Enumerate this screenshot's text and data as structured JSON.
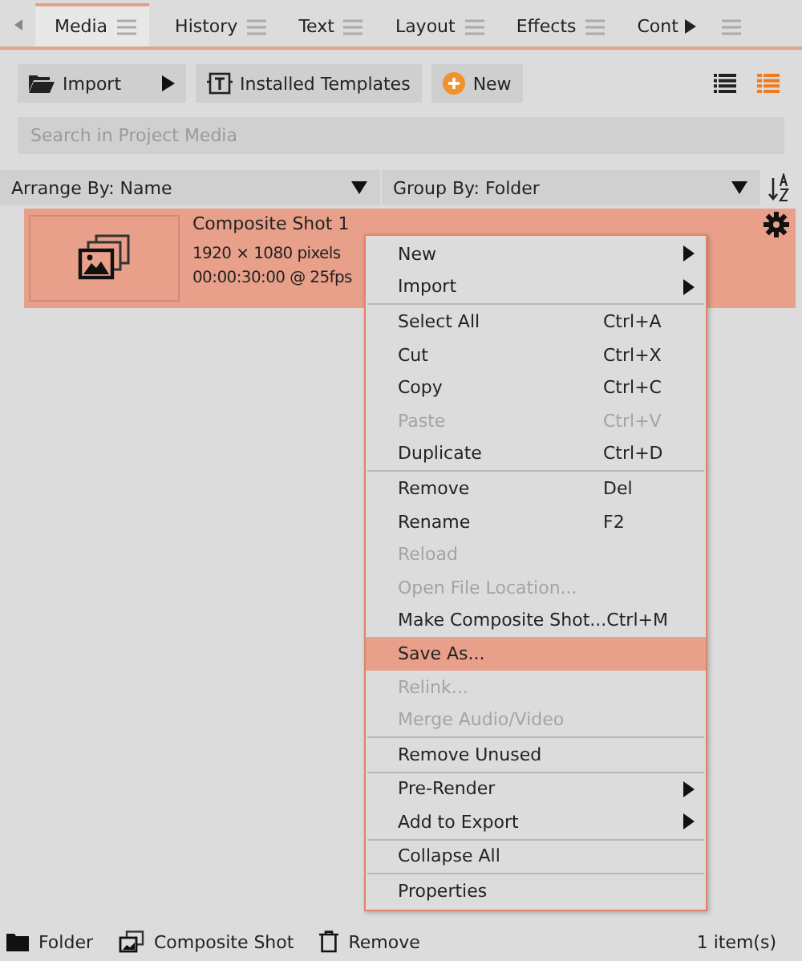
{
  "tabs": [
    {
      "label": "Media",
      "selected": true
    },
    {
      "label": "History",
      "selected": false
    },
    {
      "label": "Text",
      "selected": false
    },
    {
      "label": "Layout",
      "selected": false
    },
    {
      "label": "Effects",
      "selected": false
    },
    {
      "label": "Cont",
      "selected": false
    }
  ],
  "toolbar": {
    "buttons": [
      {
        "kind": "import",
        "label": "Import"
      },
      {
        "kind": "templates",
        "label": "Installed Templates"
      },
      {
        "kind": "new",
        "label": "New"
      }
    ],
    "views": [
      {
        "kind": "details",
        "selected": false
      },
      {
        "kind": "list",
        "selected": true
      }
    ]
  },
  "search": {
    "placeholder": "Search in Project Media"
  },
  "arrange": {
    "label": "Arrange By: Name"
  },
  "group": {
    "label": "Group By: Folder"
  },
  "media_items": [
    {
      "name": "Composite Shot 1",
      "resolution": "1920 × 1080 pixels",
      "duration": "00:00:30:00 @ 25fps",
      "selected": true
    }
  ],
  "context_menu": [
    {
      "kind": "item",
      "label": "New",
      "submenu": true,
      "disabled": false,
      "selected": false
    },
    {
      "kind": "item",
      "label": "Import",
      "submenu": true,
      "disabled": false,
      "selected": false
    },
    {
      "kind": "separator"
    },
    {
      "kind": "item",
      "label": "Select All",
      "shortcut": "Ctrl+A",
      "disabled": false,
      "selected": false
    },
    {
      "kind": "item",
      "label": "Cut",
      "shortcut": "Ctrl+X",
      "disabled": false,
      "selected": false
    },
    {
      "kind": "item",
      "label": "Copy",
      "shortcut": "Ctrl+C",
      "disabled": false,
      "selected": false
    },
    {
      "kind": "item",
      "label": "Paste",
      "shortcut": "Ctrl+V",
      "disabled": true,
      "selected": false
    },
    {
      "kind": "item",
      "label": "Duplicate",
      "shortcut": "Ctrl+D",
      "disabled": false,
      "selected": false
    },
    {
      "kind": "separator"
    },
    {
      "kind": "item",
      "label": "Remove",
      "shortcut": "Del",
      "disabled": false,
      "selected": false
    },
    {
      "kind": "item",
      "label": "Rename",
      "shortcut": "F2",
      "disabled": false,
      "selected": false
    },
    {
      "kind": "item",
      "label": "Reload",
      "disabled": true,
      "selected": false
    },
    {
      "kind": "item",
      "label": "Open File Location...",
      "disabled": true,
      "selected": false
    },
    {
      "kind": "item",
      "label": "Make Composite Shot...",
      "shortcut": "Ctrl+M",
      "disabled": false,
      "selected": false
    },
    {
      "kind": "item",
      "label": "Save As...",
      "disabled": false,
      "selected": true
    },
    {
      "kind": "item",
      "label": "Relink...",
      "disabled": true,
      "selected": false
    },
    {
      "kind": "item",
      "label": "Merge Audio/Video",
      "disabled": true,
      "selected": false
    },
    {
      "kind": "separator"
    },
    {
      "kind": "item",
      "label": "Remove Unused",
      "disabled": false,
      "selected": false
    },
    {
      "kind": "separator"
    },
    {
      "kind": "item",
      "label": "Pre-Render",
      "submenu": true,
      "disabled": false,
      "selected": false
    },
    {
      "kind": "item",
      "label": "Add to Export",
      "submenu": true,
      "disabled": false,
      "selected": false
    },
    {
      "kind": "separator"
    },
    {
      "kind": "item",
      "label": "Collapse All",
      "disabled": false,
      "selected": false
    },
    {
      "kind": "separator"
    },
    {
      "kind": "item",
      "label": "Properties",
      "disabled": false,
      "selected": false
    }
  ],
  "status_bar": {
    "actions": [
      {
        "kind": "folder",
        "label": "Folder"
      },
      {
        "kind": "composite",
        "label": "Composite Shot"
      },
      {
        "kind": "remove",
        "label": "Remove"
      }
    ],
    "count": "1 item(s)"
  }
}
